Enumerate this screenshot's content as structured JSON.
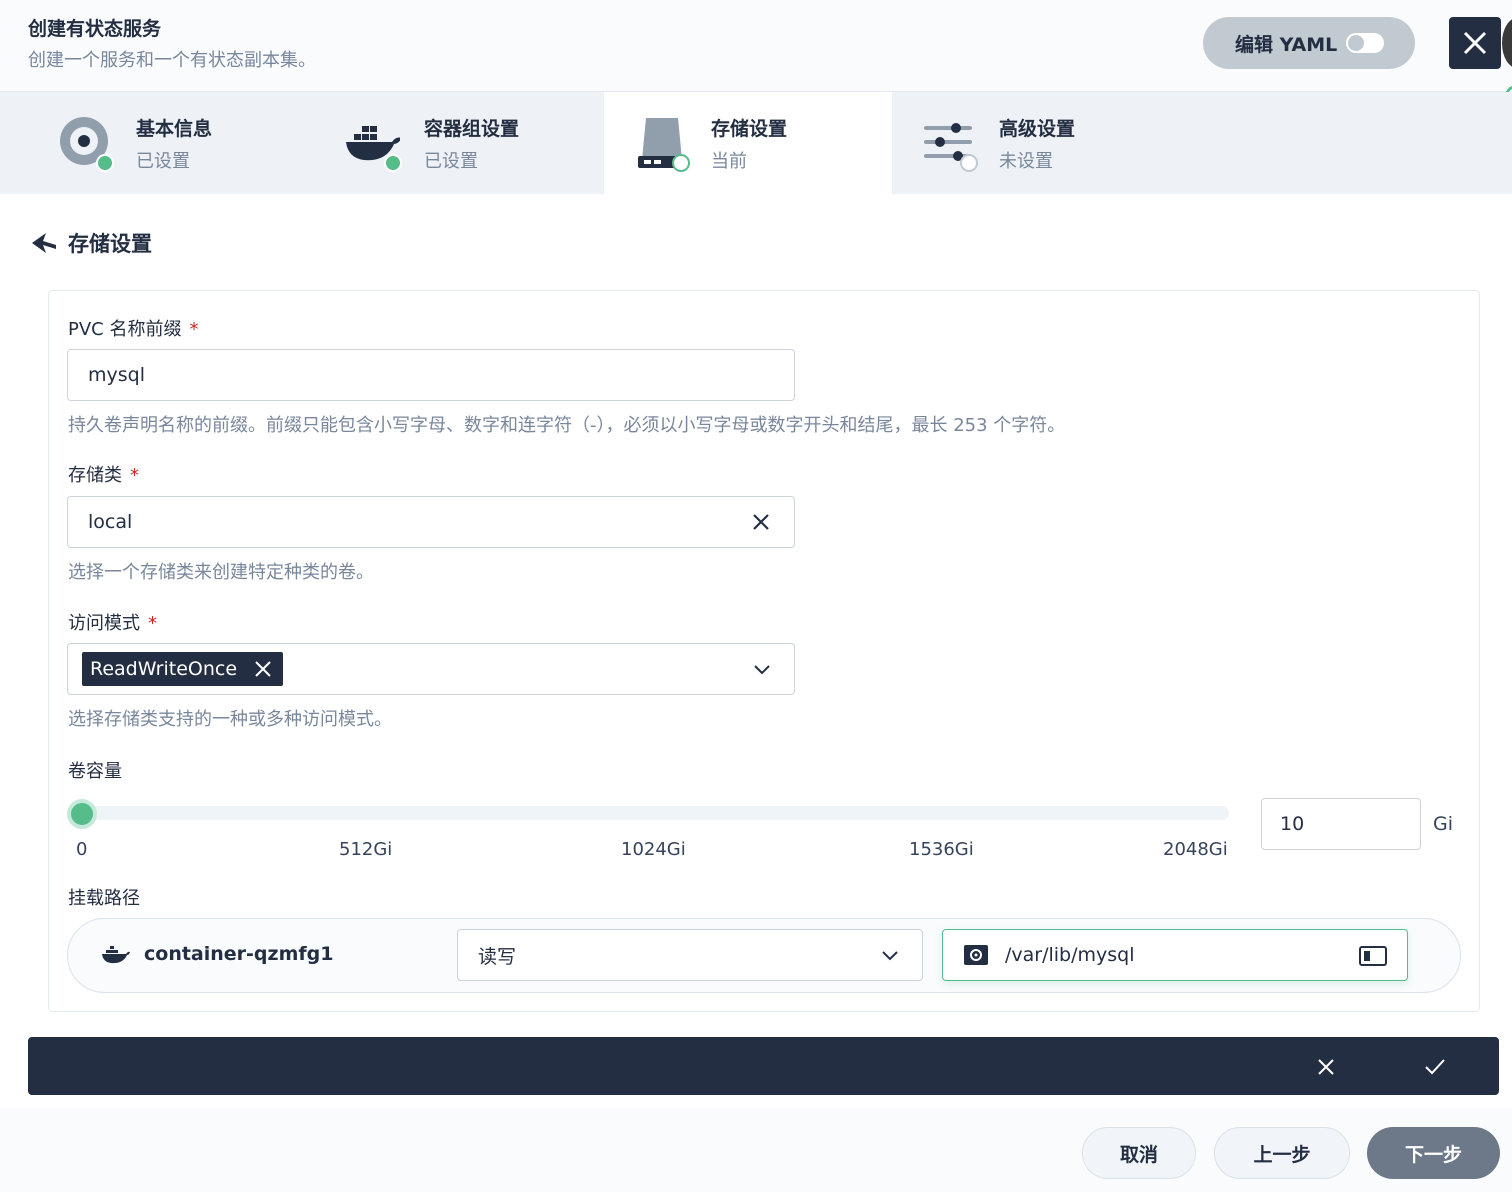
{
  "header": {
    "title": "创建有状态服务",
    "subtitle": "创建一个服务和一个有状态副本集。",
    "yaml_label": "编辑 YAML"
  },
  "steps": [
    {
      "name": "基本信息",
      "status": "已设置"
    },
    {
      "name": "容器组设置",
      "status": "已设置"
    },
    {
      "name": "存储设置",
      "status": "当前"
    },
    {
      "name": "高级设置",
      "status": "未设置"
    }
  ],
  "section_title": "存储设置",
  "form": {
    "pvc": {
      "label": "PVC 名称前缀",
      "required": "*",
      "value": "mysql",
      "hint": "持久卷声明名称的前缀。前缀只能包含小写字母、数字和连字符（-），必须以小写字母或数字开头和结尾，最长 253 个字符。"
    },
    "storage_class": {
      "label": "存储类",
      "required": "*",
      "value": "local",
      "hint": "选择一个存储类来创建特定种类的卷。"
    },
    "access_mode": {
      "label": "访问模式",
      "required": "*",
      "tag": "ReadWriteOnce",
      "hint": "选择存储类支持的一种或多种访问模式。"
    },
    "capacity": {
      "label": "卷容量",
      "value": "10",
      "unit": "Gi",
      "ticks": [
        "0",
        "512Gi",
        "1024Gi",
        "1536Gi",
        "2048Gi"
      ],
      "slider_fraction": 0
    },
    "mount": {
      "label": "挂载路径",
      "container": "container-qzmfg1",
      "mode": "读写",
      "path": "/var/lib/mysql"
    }
  },
  "footer": {
    "cancel": "取消",
    "prev": "上一步",
    "next": "下一步"
  },
  "colors": {
    "accent_green": "#55bc8a",
    "dark": "#242e42",
    "required_red": "#ca2621"
  }
}
